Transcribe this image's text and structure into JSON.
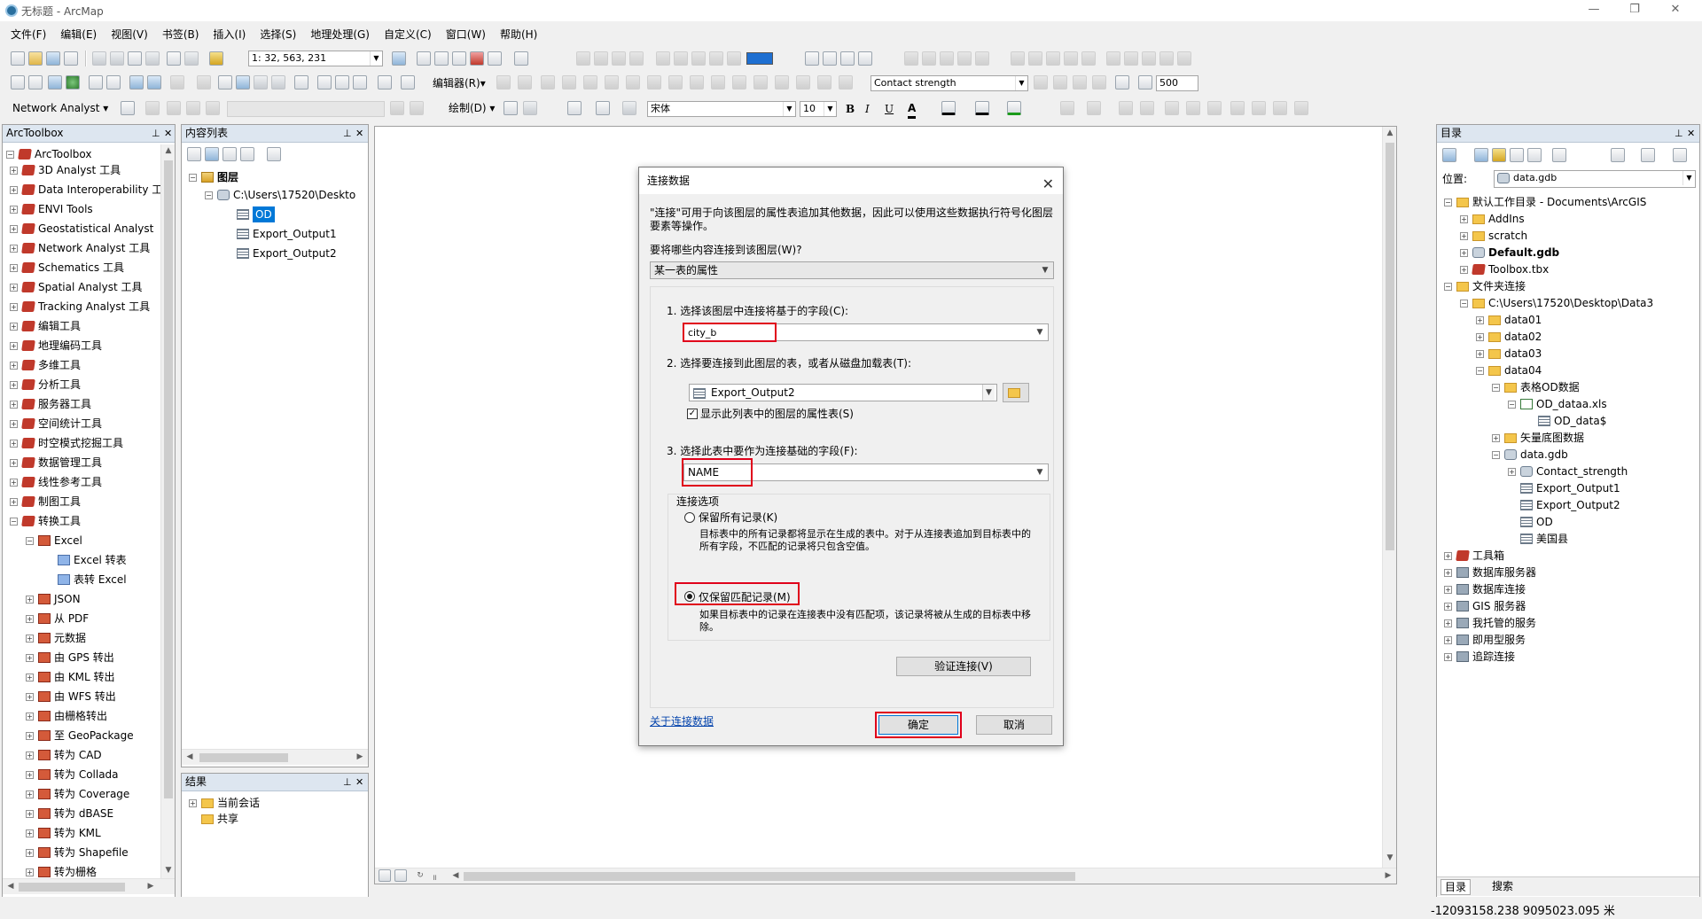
{
  "window": {
    "title": "无标题 - ArcMap",
    "minimize": "—",
    "maximize": "❐",
    "close": "✕"
  },
  "menu": [
    "文件(F)",
    "编辑(E)",
    "视图(V)",
    "书签(B)",
    "插入(I)",
    "选择(S)",
    "地理处理(G)",
    "自定义(C)",
    "窗口(W)",
    "帮助(H)"
  ],
  "toolbar": {
    "scale": "1: 32, 563, 231",
    "editor_label": "编辑器(R)▾",
    "network_analyst": "Network Analyst ▾",
    "draw_label": "绘制(D) ▾",
    "layer_combo": "Contact strength",
    "zoom_value": "500",
    "font_name": "宋体",
    "font_size": "10",
    "bold": "B",
    "italic": "I",
    "underline": "U",
    "font_color": "A"
  },
  "arctoolbox": {
    "title": "ArcToolbox",
    "root": "ArcToolbox",
    "items": [
      "3D Analyst 工具",
      "Data Interoperability 工",
      "ENVI Tools",
      "Geostatistical Analyst",
      "Network Analyst 工具",
      "Schematics 工具",
      "Spatial Analyst 工具",
      "Tracking Analyst 工具",
      "编辑工具",
      "地理编码工具",
      "多维工具",
      "分析工具",
      "服务器工具",
      "空间统计工具",
      "时空模式挖掘工具",
      "数据管理工具",
      "线性参考工具",
      "制图工具",
      "转换工具"
    ],
    "excel_group": "Excel",
    "excel_children": [
      "Excel 转表",
      "表转 Excel"
    ],
    "conversion_children": [
      "JSON",
      "从 PDF",
      "元数据",
      "由 GPS 转出",
      "由 KML 转出",
      "由 WFS 转出",
      "由栅格转出",
      "至 GeoPackage",
      "转为 CAD",
      "转为 Collada",
      "转为 Coverage",
      "转为 dBASE",
      "转为 KML",
      "转为 Shapefile",
      "转为栅格"
    ]
  },
  "toc": {
    "title": "内容列表",
    "layers": "图层",
    "path": "C:\\Users\\17520\\Deskto",
    "tables": [
      "OD",
      "Export_Output1",
      "Export_Output2"
    ]
  },
  "results": {
    "title": "结果",
    "items": [
      "当前会话",
      "共享"
    ]
  },
  "catalog": {
    "title": "目录",
    "location_label": "位置:",
    "location_value": "data.gdb",
    "items": [
      {
        "label": "默认工作目录 - Documents\\ArcGIS",
        "bold": false
      },
      {
        "label": "AddIns",
        "bold": false
      },
      {
        "label": "scratch",
        "bold": false
      },
      {
        "label": "Default.gdb",
        "bold": true
      },
      {
        "label": "Toolbox.tbx",
        "bold": false
      },
      {
        "label": "文件夹连接",
        "bold": false
      },
      {
        "label": "C:\\Users\\17520\\Desktop\\Data3",
        "bold": false
      },
      {
        "label": "data01",
        "bold": false
      },
      {
        "label": "data02",
        "bold": false
      },
      {
        "label": "data03",
        "bold": false
      },
      {
        "label": "data04",
        "bold": false
      },
      {
        "label": "表格OD数据",
        "bold": false
      },
      {
        "label": "OD_dataa.xls",
        "bold": false
      },
      {
        "label": "OD_data$",
        "bold": false
      },
      {
        "label": "矢量底图数据",
        "bold": false
      },
      {
        "label": "data.gdb",
        "bold": false
      },
      {
        "label": "Contact_strength",
        "bold": false
      },
      {
        "label": "Export_Output1",
        "bold": false
      },
      {
        "label": "Export_Output2",
        "bold": false
      },
      {
        "label": "OD",
        "bold": false
      },
      {
        "label": "美国县",
        "bold": false
      },
      {
        "label": "工具箱",
        "bold": false
      },
      {
        "label": "数据库服务器",
        "bold": false
      },
      {
        "label": "数据库连接",
        "bold": false
      },
      {
        "label": "GIS 服务器",
        "bold": false
      },
      {
        "label": "我托管的服务",
        "bold": false
      },
      {
        "label": "即用型服务",
        "bold": false
      },
      {
        "label": "追踪连接",
        "bold": false
      }
    ],
    "tab_catalog": "目录",
    "tab_search": "搜索"
  },
  "dialog": {
    "title": "连接数据",
    "description": "\"连接\"可用于向该图层的属性表追加其他数据，因此可以使用这些数据执行符号化图层要素等操作。",
    "what_label": "要将哪些内容连接到该图层(W)?",
    "what_value": "某一表的属性",
    "step1": "1.  选择该图层中连接将基于的字段(C):",
    "field1": "city_b",
    "step2": "2.  选择要连接到此图层的表，或者从磁盘加载表(T):",
    "table_value": "Export_Output2",
    "show_attr": "显示此列表中的图层的属性表(S)",
    "step3": "3.  选择此表中要作为连接基础的字段(F):",
    "field3": "NAME",
    "options_label": "连接选项",
    "keep_all": "保留所有记录(K)",
    "keep_all_desc": "目标表中的所有记录都将显示在生成的表中。对于从连接表追加到目标表中的所有字段，不匹配的记录将只包含空值。",
    "keep_match": "仅保留匹配记录(M)",
    "keep_match_desc": "如果目标表中的记录在连接表中没有匹配项，该记录将被从生成的目标表中移除。",
    "validate": "验证连接(V)",
    "about_link": "关于连接数据",
    "ok": "确定",
    "cancel": "取消",
    "selected_option": "keep_match",
    "show_attr_checked": true
  },
  "status": {
    "coords": "-12093158.238  9095023.095 米"
  },
  "colors": {
    "highlight": "#e0001b",
    "panel_header": "#dde6f0",
    "selection": "#0078d7"
  }
}
